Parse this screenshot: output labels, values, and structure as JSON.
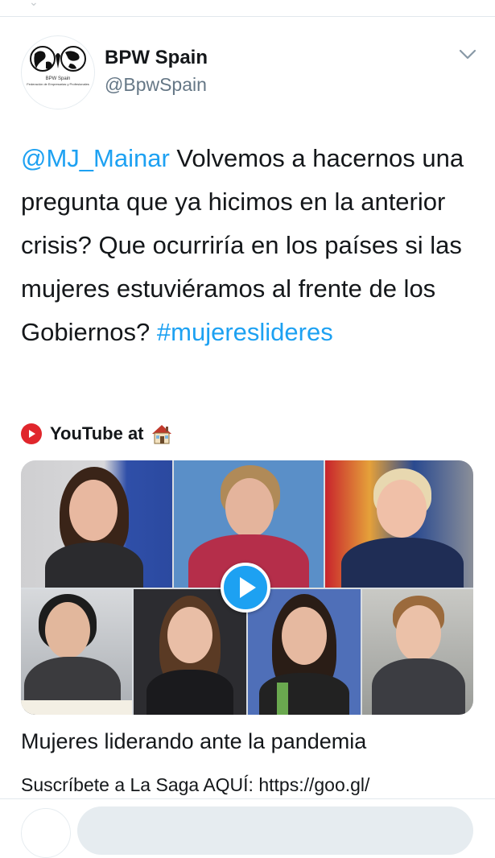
{
  "tweet": {
    "author": {
      "display_name": "BPW Spain",
      "handle": "@BpwSpain",
      "avatar_caption": "BPW Spain",
      "avatar_subcaption": "Federación de Empresarias y Profesionales"
    },
    "text": {
      "mention": "@MJ_Mainar",
      "body": " Volvemos a hacernos una pregunta que ya hicimos en la anterior crisis? Que ocurriría en los países si las mujeres estuviéramos al frente de los Gobiernos? ",
      "hashtag": "#mujereslideres"
    },
    "source": {
      "label": "YouTube at",
      "icon": "house-emoji"
    },
    "card": {
      "title": "Mujeres liderando ante la pandemia",
      "description": "Suscríbete a La Saga AQUÍ: https://goo.gl/"
    }
  },
  "colors": {
    "accent": "#1da1f2",
    "youtube_red": "#e0262c",
    "text_primary": "#14171a",
    "text_secondary": "#657786"
  },
  "icons": {
    "menu": "chevron-down-icon",
    "play": "play-icon",
    "youtube": "youtube-icon"
  }
}
